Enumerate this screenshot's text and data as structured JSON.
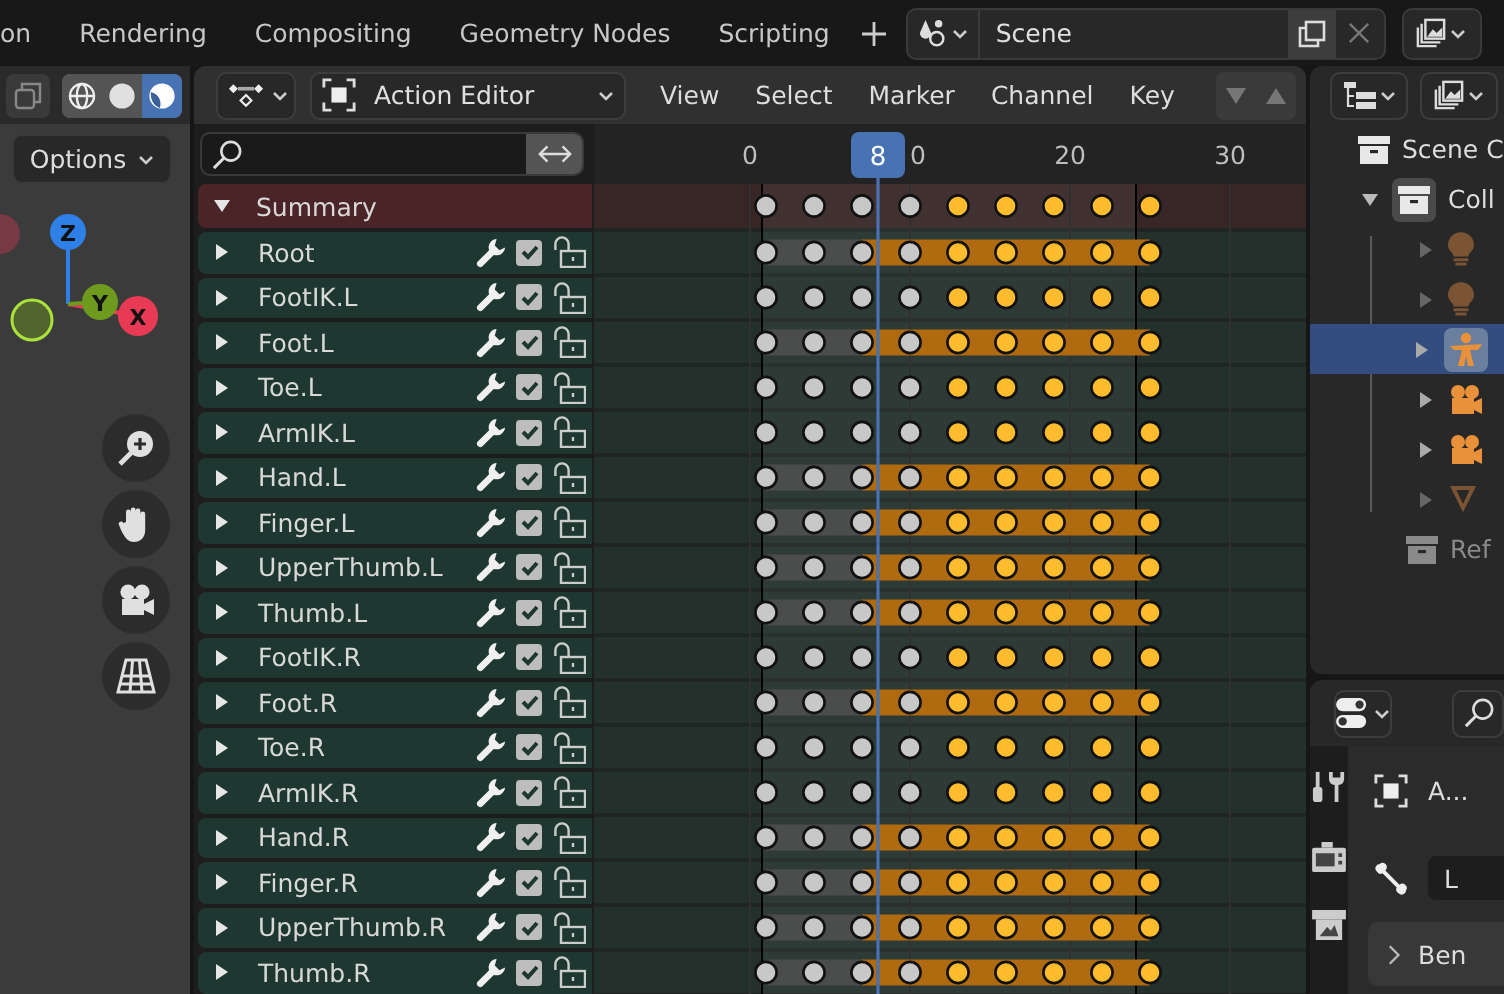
{
  "workspace_tabs": [
    {
      "label": "on",
      "selected": false
    },
    {
      "label": "Rendering",
      "selected": false
    },
    {
      "label": "Compositing",
      "selected": false
    },
    {
      "label": "Geometry Nodes",
      "selected": false
    },
    {
      "label": "Scripting",
      "selected": false
    }
  ],
  "scene": {
    "value": "Scene"
  },
  "viewport": {
    "options_label": "Options",
    "shading": [
      {
        "kind": "wireframe",
        "selected": false
      },
      {
        "kind": "solid",
        "selected": false
      },
      {
        "kind": "material",
        "selected": true
      }
    ],
    "gizmo": [
      {
        "label": "Z",
        "color": "#2f80e6"
      },
      {
        "label": "Y",
        "color": "#6e9a1e"
      },
      {
        "label": "X",
        "color": "#e83a55"
      }
    ]
  },
  "dopesheet": {
    "editor_mode": "Action Editor",
    "menus": [
      "View",
      "Select",
      "Marker",
      "Channel",
      "Key"
    ],
    "ruler": {
      "labels": [
        "0",
        "0",
        "20",
        "30"
      ],
      "current_frame": "8"
    },
    "summary": {
      "name": "Summary",
      "expanded": true
    },
    "keyframes": [
      {
        "selected": false
      },
      {
        "selected": false
      },
      {
        "selected": false
      },
      {
        "selected": false
      },
      {
        "selected": true
      },
      {
        "selected": true
      },
      {
        "selected": true
      },
      {
        "selected": true
      },
      {
        "selected": true
      }
    ],
    "channels": [
      {
        "name": "Root",
        "expanded": false,
        "checked": true,
        "locked": false,
        "hold": true
      },
      {
        "name": "FootIK.L",
        "expanded": false,
        "checked": true,
        "locked": false,
        "hold": false
      },
      {
        "name": "Foot.L",
        "expanded": false,
        "checked": true,
        "locked": false,
        "hold": true
      },
      {
        "name": "Toe.L",
        "expanded": false,
        "checked": true,
        "locked": false,
        "hold": false
      },
      {
        "name": "ArmIK.L",
        "expanded": false,
        "checked": true,
        "locked": false,
        "hold": false
      },
      {
        "name": "Hand.L",
        "expanded": false,
        "checked": true,
        "locked": false,
        "hold": true
      },
      {
        "name": "Finger.L",
        "expanded": false,
        "checked": true,
        "locked": false,
        "hold": true
      },
      {
        "name": "UpperThumb.L",
        "expanded": false,
        "checked": true,
        "locked": false,
        "hold": true
      },
      {
        "name": "Thumb.L",
        "expanded": false,
        "checked": true,
        "locked": false,
        "hold": true
      },
      {
        "name": "FootIK.R",
        "expanded": false,
        "checked": true,
        "locked": false,
        "hold": false
      },
      {
        "name": "Foot.R",
        "expanded": false,
        "checked": true,
        "locked": false,
        "hold": true
      },
      {
        "name": "Toe.R",
        "expanded": false,
        "checked": true,
        "locked": false,
        "hold": false
      },
      {
        "name": "ArmIK.R",
        "expanded": false,
        "checked": true,
        "locked": false,
        "hold": false
      },
      {
        "name": "Hand.R",
        "expanded": false,
        "checked": true,
        "locked": false,
        "hold": true
      },
      {
        "name": "Finger.R",
        "expanded": false,
        "checked": true,
        "locked": false,
        "hold": true
      },
      {
        "name": "UpperThumb.R",
        "expanded": false,
        "checked": true,
        "locked": false,
        "hold": true
      },
      {
        "name": "Thumb.R",
        "expanded": false,
        "checked": true,
        "locked": false,
        "hold": true
      }
    ]
  },
  "outliner": {
    "items": [
      {
        "label": "Scene C",
        "kind": "collection",
        "disabled": false
      },
      {
        "label": "Coll",
        "kind": "collection",
        "disabled": false,
        "expanded": true,
        "children": [
          {
            "kind": "light",
            "expanded": false,
            "selected": false,
            "disabled": true
          },
          {
            "kind": "light",
            "expanded": false,
            "selected": false,
            "disabled": true
          },
          {
            "kind": "armature",
            "expanded": false,
            "selected": true,
            "disabled": false
          },
          {
            "kind": "camera",
            "expanded": false,
            "selected": false,
            "disabled": false
          },
          {
            "kind": "camera",
            "expanded": false,
            "selected": false,
            "disabled": false
          },
          {
            "kind": "cone",
            "expanded": false,
            "selected": false,
            "disabled": true
          }
        ]
      },
      {
        "label": "Ref",
        "kind": "collection",
        "disabled": true
      }
    ]
  },
  "properties": {
    "action_label": "A...",
    "bone_field": "L",
    "panel": {
      "label": "Ben",
      "expanded": false
    }
  }
}
